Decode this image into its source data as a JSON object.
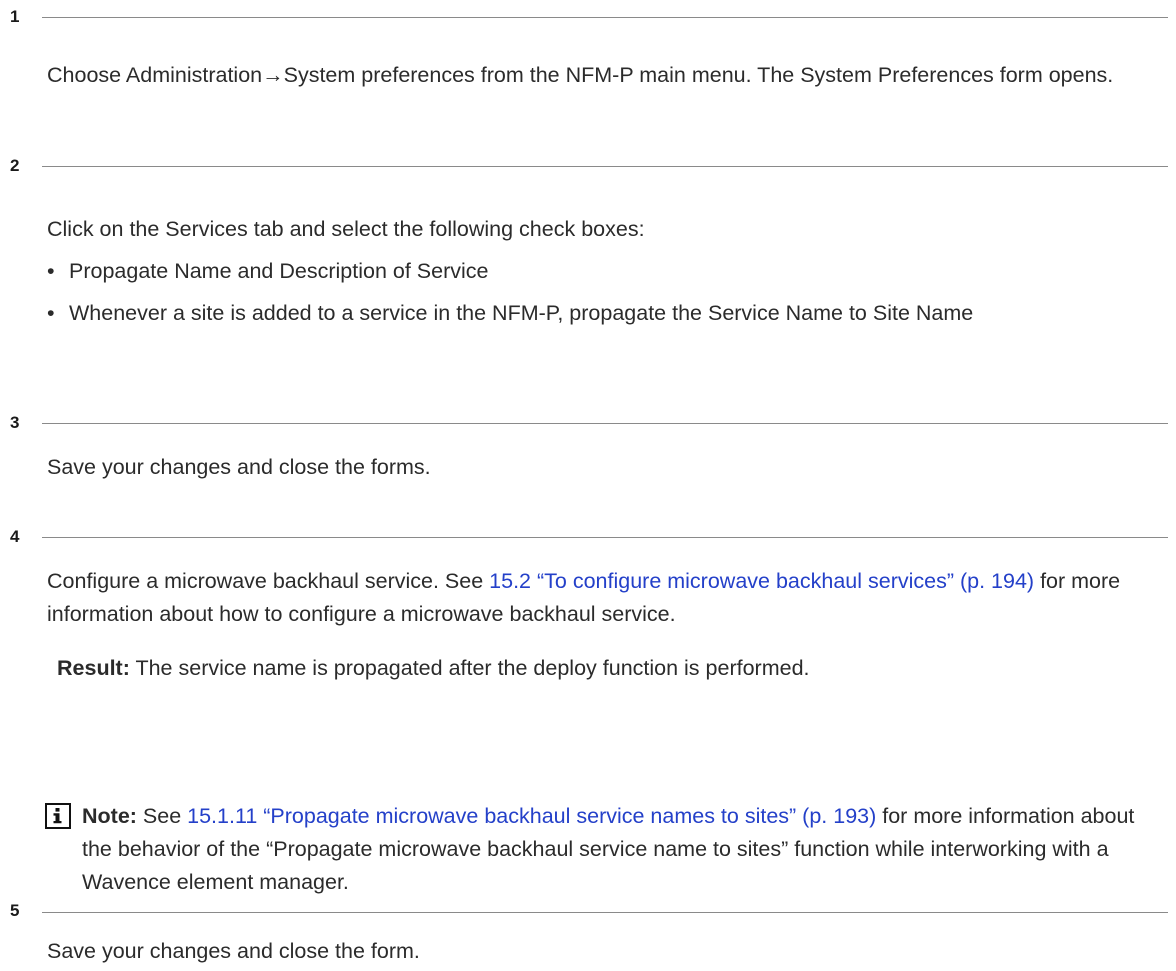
{
  "steps": [
    {
      "number": "1",
      "paragraphs": [
        "Choose Administration→System preferences from the NFM-P main menu. The System Preferences form opens."
      ]
    },
    {
      "number": "2",
      "intro": "Click on the Services tab and select the following check boxes:",
      "bullets": [
        "Propagate Name and Description of Service",
        "Whenever a site is added to a service in the NFM-P, propagate the Service Name to Site Name"
      ],
      "bullet_symbol": "•"
    },
    {
      "number": "3",
      "paragraphs": [
        "Save your changes and close the forms."
      ]
    },
    {
      "number": "4",
      "text_before_link": "Configure a microwave backhaul service. See ",
      "link_text": "15.2 “To configure microwave backhaul services” (p. 194)",
      "text_after_link": " for more information about how to configure a microwave backhaul service.",
      "result_label": "Result:",
      "result_text": " The service name is propagated after the deploy function is performed.",
      "note": {
        "icon": "info-icon",
        "label": "Note:",
        "text_before_link": " See ",
        "link_text": "15.1.11 “Propagate microwave backhaul service names to sites” (p. 193)",
        "text_after_link": " for more information about the behavior of the “Propagate microwave backhaul service name to sites” function while interworking with a Wavence element manager."
      }
    },
    {
      "number": "5",
      "paragraphs": [
        "Save your changes and close the form."
      ]
    }
  ],
  "colors": {
    "link": "#2440c9",
    "text": "#2b2b2b",
    "rule": "#8a8a8a"
  }
}
